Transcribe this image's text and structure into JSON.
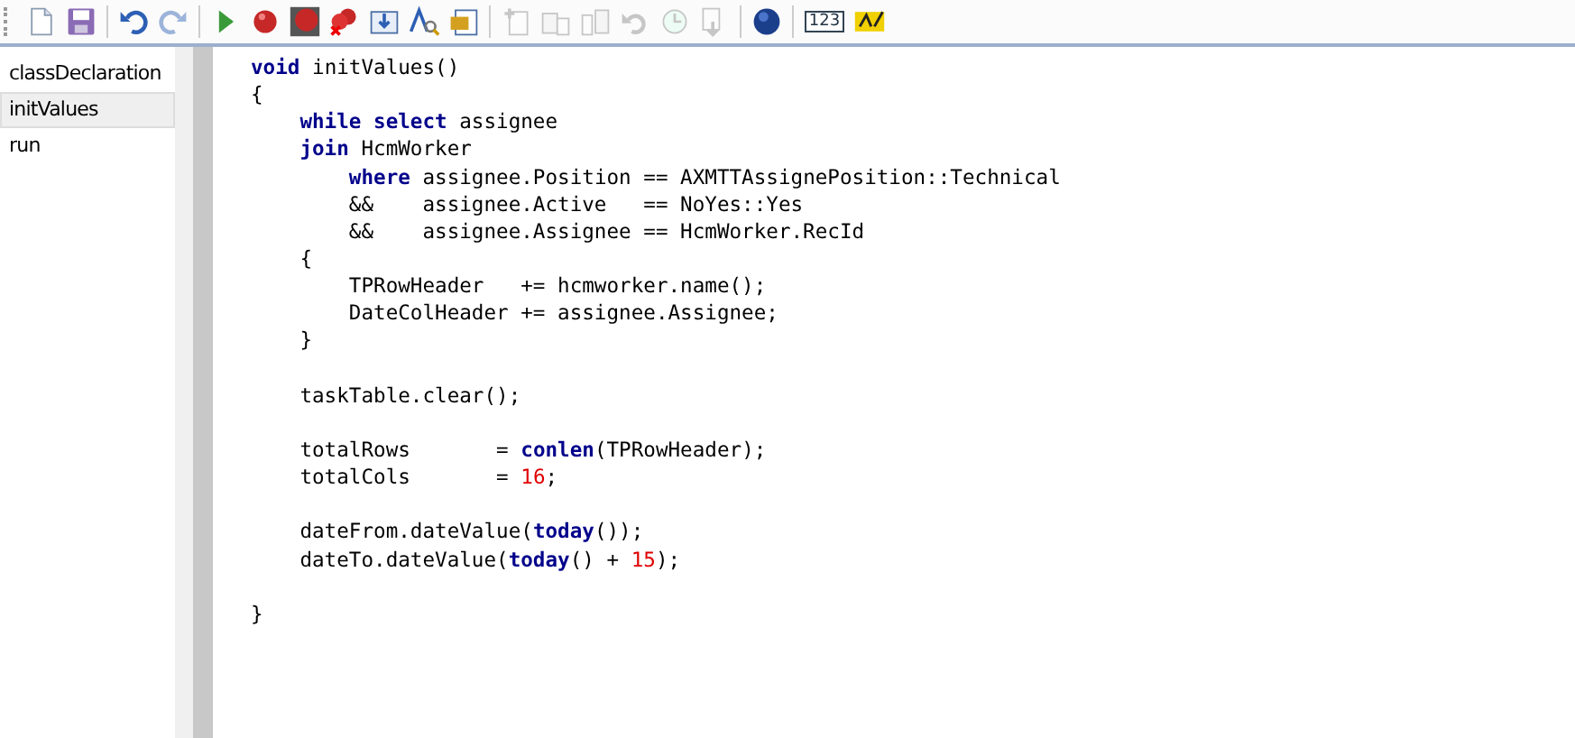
{
  "toolbar": {
    "groups": [
      [
        {
          "kind": "new",
          "disabled": false
        },
        {
          "kind": "save",
          "disabled": false
        }
      ],
      [
        {
          "kind": "undo",
          "disabled": false
        },
        {
          "kind": "redo",
          "disabled": true
        }
      ],
      [
        {
          "kind": "run",
          "disabled": false
        },
        {
          "kind": "breakpoint",
          "disabled": false
        },
        {
          "kind": "breakpoint-toggle",
          "disabled": false
        },
        {
          "kind": "breakpoint-clear",
          "disabled": false
        },
        {
          "kind": "compile",
          "disabled": false
        },
        {
          "kind": "find",
          "disabled": false
        },
        {
          "kind": "script",
          "disabled": false
        }
      ],
      [
        {
          "kind": "copy",
          "disabled": true
        },
        {
          "kind": "table-add",
          "disabled": true
        },
        {
          "kind": "table-split",
          "disabled": true
        },
        {
          "kind": "revert",
          "disabled": true
        },
        {
          "kind": "history",
          "disabled": true
        },
        {
          "kind": "download",
          "disabled": true
        }
      ],
      [
        {
          "kind": "help",
          "disabled": false
        }
      ],
      [
        {
          "kind": "counter",
          "label": "123",
          "disabled": false
        },
        {
          "kind": "spell",
          "disabled": false
        }
      ]
    ]
  },
  "methods": [
    {
      "label": "classDeclaration",
      "selected": false
    },
    {
      "label": "initValues",
      "selected": true
    },
    {
      "label": "run",
      "selected": false
    }
  ],
  "editor": {
    "blocks": [
      [
        [
          {
            "text": "void",
            "kind": "keyword"
          },
          {
            "text": " initValues()",
            "kind": "plain"
          }
        ],
        [
          {
            "text": "{",
            "kind": "plain"
          }
        ],
        [
          {
            "text": "    while select",
            "kind": "keyword"
          },
          {
            "text": " assignee",
            "kind": "plain"
          }
        ],
        [
          {
            "text": "    join",
            "kind": "keyword"
          },
          {
            "text": " HcmWorker",
            "kind": "plain"
          }
        ],
        [
          {
            "text": "        where",
            "kind": "keyword"
          },
          {
            "text": " assignee.Position == AXMTTAssignePosition::Technical",
            "kind": "plain"
          }
        ],
        [
          {
            "text": "        &&    assignee.Active   == NoYes::Yes",
            "kind": "plain"
          }
        ],
        [
          {
            "text": "        &&    assignee.Assignee == HcmWorker.RecId",
            "kind": "plain"
          }
        ],
        [
          {
            "text": "    {",
            "kind": "plain"
          }
        ],
        [
          {
            "text": "        TPRowHeader   += hcmworker.name();",
            "kind": "plain"
          }
        ],
        [
          {
            "text": "        DateColHeader += assignee.Assignee;",
            "kind": "plain"
          }
        ],
        [
          {
            "text": "    }",
            "kind": "plain"
          }
        ]
      ],
      [
        [
          {
            "text": "    taskTable.clear();",
            "kind": "plain"
          }
        ]
      ],
      [
        [
          {
            "text": "    totalRows       = ",
            "kind": "plain"
          },
          {
            "text": "conlen",
            "kind": "keyword"
          },
          {
            "text": "(TPRowHeader);",
            "kind": "plain"
          }
        ],
        [
          {
            "text": "    totalCols       = ",
            "kind": "plain"
          },
          {
            "text": "16",
            "kind": "number"
          },
          {
            "text": ";",
            "kind": "plain"
          }
        ]
      ],
      [
        [
          {
            "text": "    dateFrom.dateValue(",
            "kind": "plain"
          },
          {
            "text": "today",
            "kind": "keyword"
          },
          {
            "text": "());",
            "kind": "plain"
          }
        ],
        [
          {
            "text": "    dateTo.dateValue(",
            "kind": "plain"
          },
          {
            "text": "today",
            "kind": "keyword"
          },
          {
            "text": "() + ",
            "kind": "plain"
          },
          {
            "text": "15",
            "kind": "number"
          },
          {
            "text": ");",
            "kind": "plain"
          }
        ]
      ],
      [
        [
          {
            "text": "}",
            "kind": "plain"
          }
        ]
      ]
    ]
  }
}
